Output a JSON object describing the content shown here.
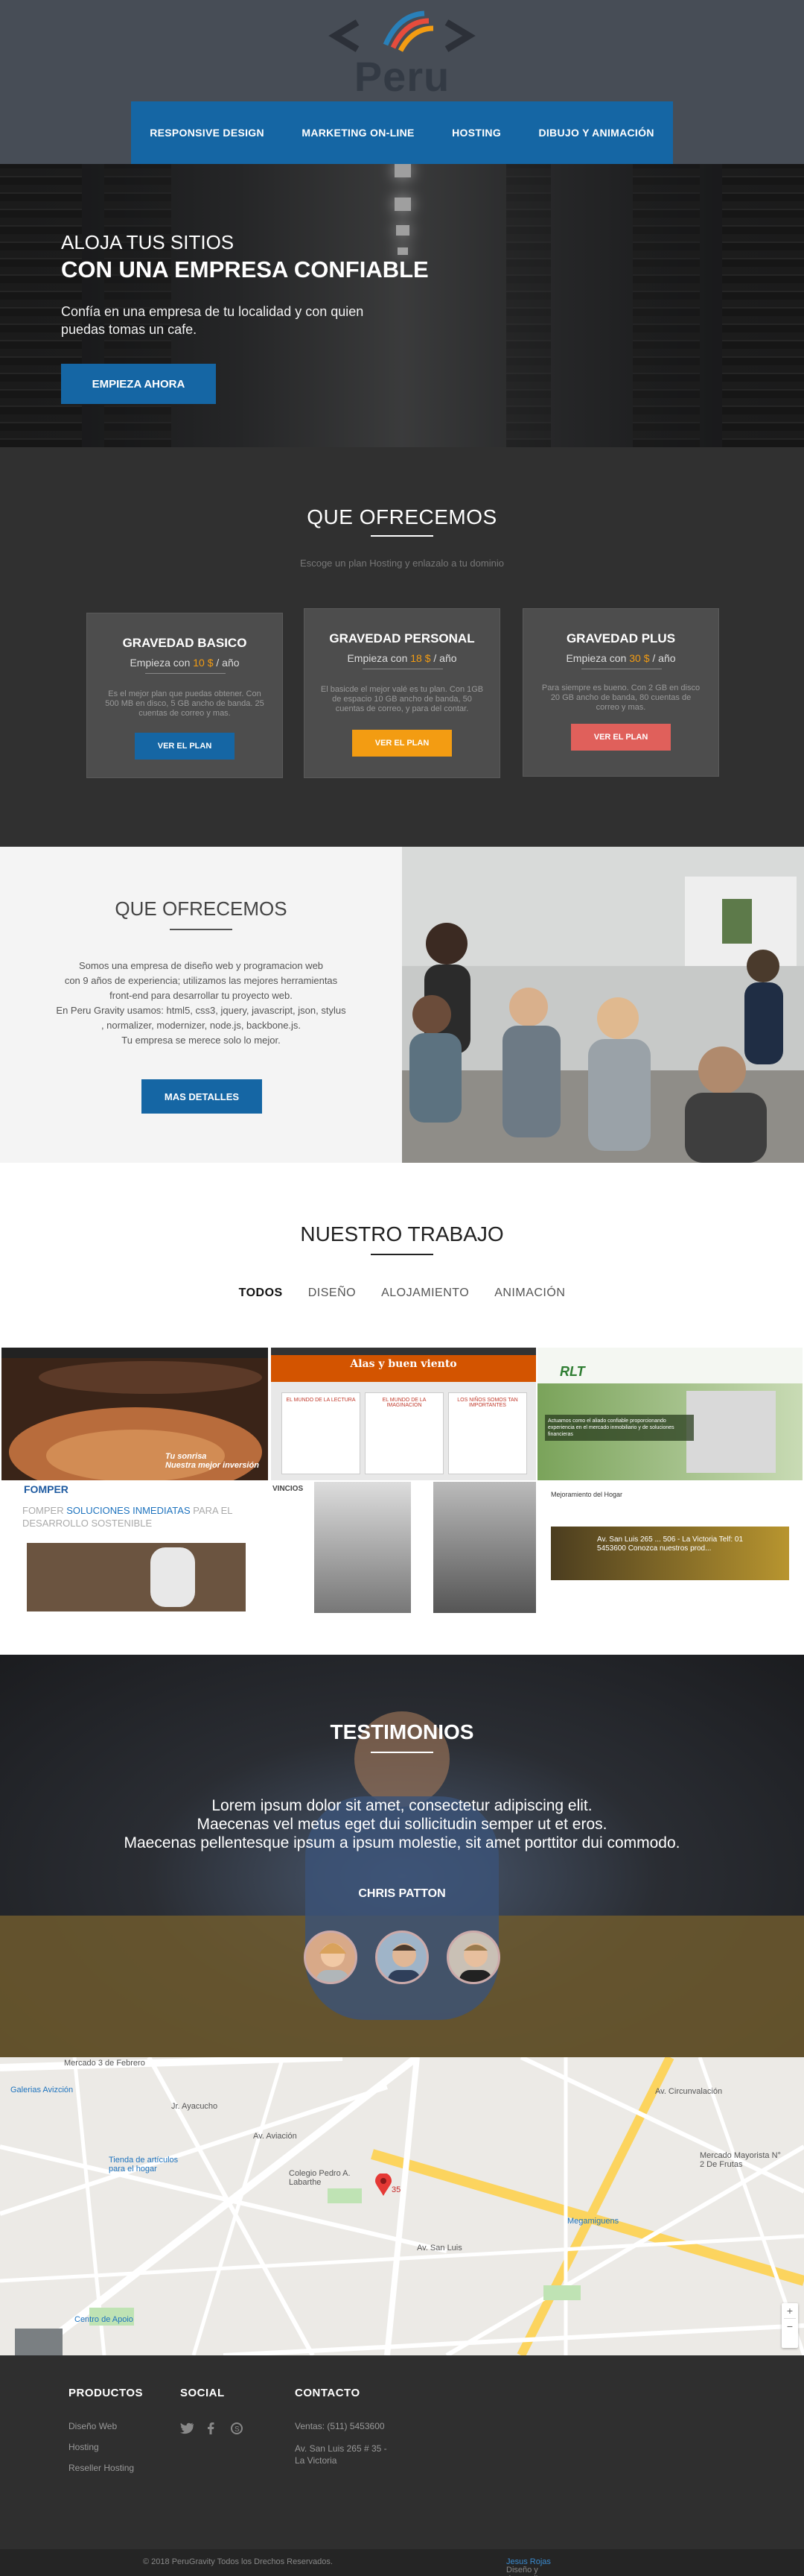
{
  "logo": {
    "text": "Peru Gravity"
  },
  "nav": [
    "RESPONSIVE DESIGN",
    "MARKETING ON-LINE",
    "HOSTING",
    "DIBUJO Y ANIMACIÓN"
  ],
  "hero": {
    "line1": "ALOJA TUS SITIOS",
    "line2": "CON UNA EMPRESA CONFIABLE",
    "text": "Confía en una empresa de tu localidad y con quien puedas tomas un cafe.",
    "button": "EMPIEZA AHORA"
  },
  "plans": {
    "title": "QUE OFRECEMOS",
    "subtitle": "Escoge un plan Hosting y enlazalo a tu dominio",
    "cards": [
      {
        "name": "GRAVEDAD BASICO",
        "price_pre": "Empieza con",
        "price": "10 $",
        "price_post": "/ año",
        "desc": "Es el mejor plan que puedas obtener. Con 500 MB en disco, 5 GB ancho de banda. 25 cuentas de correo y mas.",
        "button": "VER EL PLAN",
        "color": "#1566a4"
      },
      {
        "name": "GRAVEDAD PERSONAL",
        "price_pre": "Empieza con",
        "price": "18 $",
        "price_post": "/ año",
        "desc": "El basicde el mejor valé es tu plan. Con 1GB de espacio 10 GB ancho de banda, 50 cuentas de correo, y para del contar.",
        "button": "VER EL PLAN",
        "color": "#f39c12"
      },
      {
        "name": "GRAVEDAD PLUS",
        "price_pre": "Empieza con",
        "price": "30 $",
        "price_post": "/ año",
        "desc": "Para siempre es bueno. Con 2 GB en disco 20 GB ancho de banda, 80 cuentas de correo y mas.",
        "button": "VER EL PLAN",
        "color": "#e0605b"
      }
    ]
  },
  "about": {
    "title": "QUE OFRECEMOS",
    "lines": [
      "Somos una empresa de diseño web y programacion web",
      "con 9 años de experiencia; utilizamos las mejores herramientas",
      "front-end para desarrollar tu proyecto web.",
      "En Peru Gravity usamos: html5, css3, jquery, javascript, json, stylus",
      ", normalizer, modernizer, node.js, backbone.js.",
      "Tu empresa se merece solo lo mejor."
    ],
    "button": "MAS DETALLES"
  },
  "work": {
    "title": "NUESTRO TRABAJO",
    "filters": [
      "TODOS",
      "DISEÑO",
      "ALOJAMIENTO",
      "ANIMACIÓN"
    ],
    "thumbs": [
      {
        "caption1": "Tu sonrisa",
        "caption2": "Nuestra mejor inversión"
      },
      {
        "title": "Alas y buen viento",
        "cols": [
          "EL MUNDO DE LA LECTURA",
          "EL MUNDO DE LA IMAGINACION",
          "LOS NIÑOS SOMOS TAN IMPORTANTES"
        ]
      },
      {
        "brand": "RLT",
        "text": "Actuamos como el aliado confiable proporcionando experiencia en el mercado inmobiliario y de soluciones financieras"
      },
      {
        "brand": "FOMPER",
        "text1": "FOMPER",
        "text2": "SOLUCIONES INMEDIATAS",
        "text3": "PARA EL DESARROLLO SOSTENIBLE"
      },
      {
        "brand": "VINCIOS"
      },
      {
        "title": "Mejoramiento del Hogar",
        "text": "Av. San Luis 265 ... 506 - La Victoria Telf: 01 5453600 Conozca nuestros prod..."
      }
    ]
  },
  "testimonials": {
    "title": "TESTIMONIOS",
    "quote": [
      "Lorem ipsum dolor sit amet, consectetur adipiscing elit.",
      "Maecenas vel metus eget dui sollicitudin semper ut et eros.",
      "Maecenas pellentesque ipsum a ipsum molestie, sit amet porttitor dui commodo."
    ],
    "name": "CHRIS PATTON"
  },
  "map": {
    "labels": [
      "Mercado 3 de Febrero",
      "Galerias Avizción",
      "Tienda de artículos para el hogar",
      "Colegio Pedro A. Labarthe",
      "35",
      "Mercado Mayorista N° 2 De Frutas",
      "Megamiguens",
      "Centro de Apoio",
      "Av. Aviación",
      "Av. San Luis",
      "Jr. Ayacucho",
      "Av. Circunvalación"
    ],
    "zoom_in": "+",
    "zoom_out": "−"
  },
  "footer": {
    "cols": [
      {
        "title": "PRODUCTOS",
        "items": [
          "Diseño Web",
          "Hosting",
          "Reseller Hosting"
        ]
      },
      {
        "title": "SOCIAL",
        "items": []
      },
      {
        "title": "CONTACTO",
        "items": [
          "Ventas: (511) 5453600",
          "Av. San Luis 265 # 35 -",
          "La Victoria"
        ]
      }
    ],
    "copyright": "© 2018 PeruGravity Todos los Drechos Reservados.",
    "credit_pre": "Diseño y desarrollo por",
    "credit_name": "Jesus Rojas"
  }
}
